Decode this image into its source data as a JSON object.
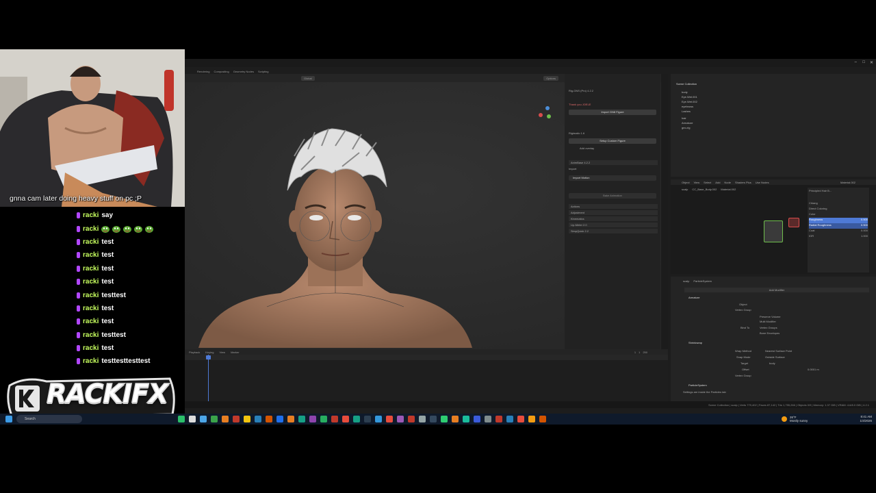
{
  "webcam": {
    "caption": "gnna cam later doing heavy stuff on pc ;P"
  },
  "chat": {
    "username": "racki",
    "messages": [
      {
        "user": "racki",
        "text": "say",
        "emotes": 0
      },
      {
        "user": "racki",
        "text": "",
        "emotes": 5
      },
      {
        "user": "racki",
        "text": "test",
        "emotes": 0
      },
      {
        "user": "racki",
        "text": "test",
        "emotes": 0
      },
      {
        "user": "racki",
        "text": "test",
        "emotes": 0
      },
      {
        "user": "racki",
        "text": "test",
        "emotes": 0
      },
      {
        "user": "racki",
        "text": "testtest",
        "emotes": 0
      },
      {
        "user": "racki",
        "text": "test",
        "emotes": 0
      },
      {
        "user": "racki",
        "text": "test",
        "emotes": 0
      },
      {
        "user": "racki",
        "text": "testtest",
        "emotes": 0
      },
      {
        "user": "racki",
        "text": "test",
        "emotes": 0
      },
      {
        "user": "racki",
        "text": "testtesttesttest",
        "emotes": 0
      }
    ],
    "user_color": "#c7ff5f",
    "badge_color": "#b247ff"
  },
  "logo": {
    "text": "RACKIFX"
  },
  "blender": {
    "workspace_tabs": [
      "Rendering",
      "Compositing",
      "Geometry Nodes",
      "Scripting"
    ],
    "viewport_header": {
      "orientation": "Global",
      "options": "Options"
    },
    "npanel": {
      "addon_title": "Rig-GNS (Pro) 4.2.2",
      "thank_you": "Thank you JOELE",
      "import_button": "Import GN8 Figure",
      "rigify_label": "Rigimatic 1.6",
      "setup_button": "Setup Custom Figure",
      "add_overlay": "Add overlay",
      "animbase": "AnimBase 4.2.2",
      "import_label": "Import",
      "import_motion": "Import Motion",
      "bake_animation": "Bake Animation",
      "sections": [
        "Actions",
        "Adjustment",
        "Kinematics",
        "Lip-Meter 2.0",
        "SimpQuick 2.2"
      ]
    },
    "outliner": {
      "title": "Scene Collection",
      "items": [
        "body",
        "Eye.Wet.001",
        "Eye.Wet.002",
        "eyebrows",
        "Lashes",
        "hair",
        "Armature",
        "geo-rig"
      ]
    },
    "shader_editor": {
      "menus": [
        "Object",
        "View",
        "Select",
        "Add",
        "Node",
        "Shaders Plus",
        "Use Nodes"
      ],
      "material": "Material.002",
      "breadcrumb": [
        "scalp",
        "CC_Base_Body.002",
        "Material.002"
      ],
      "props": [
        "Principled Hair B...",
        "Chiang",
        "Direct Coloring",
        "Color",
        "Roughness",
        "Radial Roughness",
        "Coat",
        "IOR"
      ],
      "values": [
        "0.500",
        "0.500",
        "0.000",
        "1.000"
      ]
    },
    "properties": {
      "breadcrumb": [
        "scalp",
        "ParticleSystem"
      ],
      "add_modifier": "Add Modifier",
      "modifiers": [
        "Armature",
        "Shrinkwrap",
        "ParticleSystem"
      ],
      "rows": [
        "Object",
        "Vertex Group",
        "Preserve Volume",
        "Multi Modifier",
        "Bind To",
        "Vertex Groups",
        "Bone Envelopes",
        "Wrap Method",
        "Snap Mode",
        "Target",
        "Offset",
        "Vertex Group"
      ],
      "wrap_method_value": "Nearest Surface Point",
      "snap_mode_value": "Outside Surface",
      "target_value": "body",
      "offset_value": "0.0001 m",
      "particles_note": "Settings are inside the Particles tab"
    },
    "timeline": {
      "menus": [
        "Playback",
        "Keying",
        "View",
        "Marker"
      ],
      "frame": "1",
      "start": "1",
      "end": "250"
    },
    "statusbar": "Scene Collection | scalp | Verts 779,402 | Faces 87,142 | Tris 1,755,266 | Objects 0/9 | Memory: 1.37 GiB | VRAM: 4.6/8.0 GiB | 4.2.1"
  },
  "taskbar": {
    "search_placeholder": "Search",
    "weather_temp": "26°F",
    "weather_desc": "Mostly sunny",
    "time": "8:41 AM",
    "date": "1/4/2026"
  }
}
